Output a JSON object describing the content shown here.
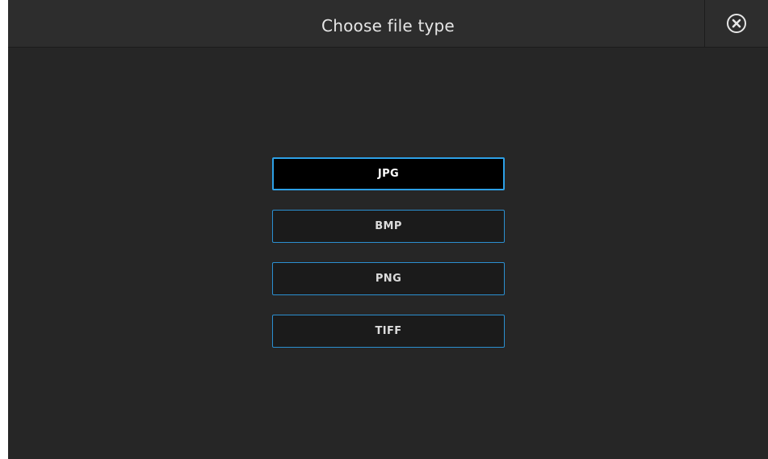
{
  "dialog": {
    "title": "Choose file type",
    "close_icon": "close-circle-icon"
  },
  "options": [
    {
      "label": "JPG",
      "selected": true
    },
    {
      "label": "BMP",
      "selected": false
    },
    {
      "label": "PNG",
      "selected": false
    },
    {
      "label": "TIFF",
      "selected": false
    }
  ],
  "colors": {
    "accent": "#2b8fd0",
    "background": "#262626",
    "titlebar": "#2d2d2d"
  }
}
